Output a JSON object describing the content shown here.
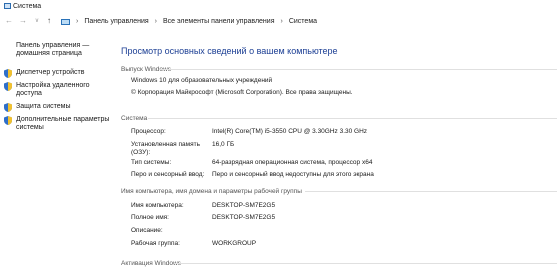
{
  "window": {
    "title": "Система"
  },
  "address": {
    "breadcrumbs": [
      "Панель управления",
      "Все элементы панели управления",
      "Система"
    ]
  },
  "sidebar": {
    "home": "Панель управления — домашняя страница",
    "links": [
      {
        "label": "Диспетчер устройств"
      },
      {
        "label": "Настройка удаленного доступа"
      },
      {
        "label": "Защита системы"
      },
      {
        "label": "Дополнительные параметры системы"
      }
    ]
  },
  "main": {
    "title": "Просмотр основных сведений о вашем компьютере",
    "edition": {
      "heading": "Выпуск Windows",
      "name": "Windows 10 для образовательных учреждений",
      "copyright": "© Корпорация Майкрософт (Microsoft Corporation). Все права защищены."
    },
    "system": {
      "heading": "Система",
      "rows": [
        {
          "label": "Процессор:",
          "value": "Intel(R) Core(TM) i5-3550 CPU @ 3.30GHz   3.30 GHz"
        },
        {
          "label": "Установленная память (ОЗУ):",
          "value": "16,0 ГБ"
        },
        {
          "label": "Тип системы:",
          "value": "64-разрядная операционная система, процессор x64"
        },
        {
          "label": "Перо и сенсорный ввод:",
          "value": "Перо и сенсорный ввод недоступны для этого экрана"
        }
      ]
    },
    "computer": {
      "heading": "Имя компьютера, имя домена и параметры рабочей группы",
      "rows": [
        {
          "label": "Имя компьютера:",
          "value": "DESKTOP-SM7E2G5"
        },
        {
          "label": "Полное имя:",
          "value": "DESKTOP-SM7E2G5"
        },
        {
          "label": "Описание:",
          "value": ""
        },
        {
          "label": "Рабочая группа:",
          "value": "WORKGROUP"
        }
      ]
    },
    "activation": {
      "heading": "Активация Windows"
    }
  }
}
